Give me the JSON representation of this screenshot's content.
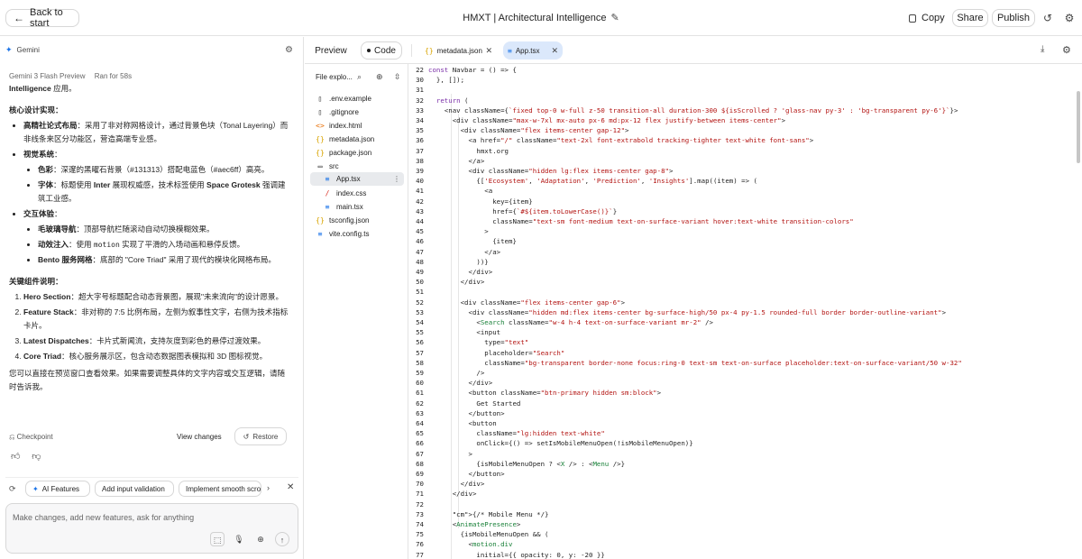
{
  "topbar": {
    "back_label": "Back to start",
    "title": "HMXT | Architectural Intelligence",
    "copy_label": "Copy",
    "share_label": "Share",
    "publish_label": "Publish"
  },
  "chat": {
    "header": "Gemini",
    "model": "Gemini 3 Flash Preview",
    "runtime": "Ran for 58s",
    "intro_bold": "Intelligence",
    "intro_rest": " 应用。",
    "section1_title": "核心设计实现：",
    "b1_title": "高精社论式布局",
    "b1_text": "：采用了非对称网格设计，通过背景色块（Tonal Layering）而非线条来区分功能区，营造高端专业感。",
    "b2_title": "视觉系统",
    "b2_sub1_title": "色彩",
    "b2_sub1_text": "：深邃的黑曜石背景（#131313）搭配电蓝色（#aec6ff）高亮。",
    "b2_sub2_title": "字体",
    "b2_sub2_text_a": "：标题使用 ",
    "b2_sub2_inter": "Inter",
    "b2_sub2_text_b": " 展现权威感，技术标签使用 ",
    "b2_sub2_grotesk": "Space Grotesk",
    "b2_sub2_text_c": " 强调建筑工业感。",
    "b3_title": "交互体验",
    "b3_sub1_title": "毛玻璃导航",
    "b3_sub1_text": "：顶部导航栏随滚动自动切换模糊效果。",
    "b3_sub2_title": "动效注入",
    "b3_sub2_text_a": "：使用 ",
    "b3_sub2_code": "motion",
    "b3_sub2_text_b": " 实现了平滑的入场动画和悬停反馈。",
    "b3_sub3_title": "Bento 服务网格",
    "b3_sub3_text": "：底部的 \"Core Triad\" 采用了现代的模块化网格布局。",
    "section2_title": "关键组件说明：",
    "o1_title": "Hero Section",
    "o1_text": "：超大字号标题配合动态背景图，展现\"未来流向\"的设计愿景。",
    "o2_title": "Feature Stack",
    "o2_text": "：非对称的 7:5 比例布局，左侧为叙事性文字，右侧为技术指标卡片。",
    "o3_title": "Latest Dispatches",
    "o3_text": "：卡片式新闻流，支持灰度到彩色的悬停过渡效果。",
    "o4_title": "Core Triad",
    "o4_text": "：核心服务展示区，包含动态数据图表模拟和 3D 图标视觉。",
    "closing": "您可以直接在预览窗口查看效果。如果需要调整具体的文字内容或交互逻辑，请随时告诉我。",
    "checkpoint_label": "Checkpoint",
    "view_changes_label": "View changes",
    "restore_label": "Restore",
    "suggestions": [
      "AI Features",
      "Add input validation",
      "Implement smooth scro"
    ],
    "prompt_placeholder": "Make changes, add new features, ask for anything"
  },
  "editor": {
    "preview_label": "Preview",
    "code_label": "Code",
    "tabs": [
      {
        "label": "metadata.json",
        "icon": "{}"
      },
      {
        "label": "App.tsx",
        "icon": "≡"
      }
    ]
  },
  "explorer": {
    "title": "File explo...",
    "files": [
      {
        "name": ".env.example",
        "icon": "file-icon"
      },
      {
        "name": ".gitignore",
        "icon": "file-icon"
      },
      {
        "name": "index.html",
        "icon": "html-icon"
      },
      {
        "name": "metadata.json",
        "icon": "json-icon"
      },
      {
        "name": "package.json",
        "icon": "json-icon"
      },
      {
        "name": "src",
        "icon": "folder-icon"
      },
      {
        "name": "App.tsx",
        "icon": "tsx-icon"
      },
      {
        "name": "index.css",
        "icon": "css-icon"
      },
      {
        "name": "main.tsx",
        "icon": "tsx-icon"
      },
      {
        "name": "tsconfig.json",
        "icon": "json-icon"
      },
      {
        "name": "vite.config.ts",
        "icon": "ts-icon"
      }
    ]
  },
  "code": {
    "lines": [
      {
        "n": "22",
        "t": "const Navbar = () => {"
      },
      {
        "n": "30",
        "t": "  }, []);"
      },
      {
        "n": "31",
        "t": ""
      },
      {
        "n": "32",
        "t": "  return ("
      },
      {
        "n": "33",
        "t": "    <nav className={`fixed top-0 w-full z-50 transition-all duration-300 ${isScrolled ? 'glass-nav py-3' : 'bg-transparent py-6'}`}>"
      },
      {
        "n": "34",
        "t": "      <div className=\"max-w-7xl mx-auto px-6 md:px-12 flex justify-between items-center\">"
      },
      {
        "n": "35",
        "t": "        <div className=\"flex items-center gap-12\">"
      },
      {
        "n": "36",
        "t": "          <a href=\"/\" className=\"text-2xl font-extrabold tracking-tighter text-white font-sans\">"
      },
      {
        "n": "37",
        "t": "            hmxt.org"
      },
      {
        "n": "38",
        "t": "          </a>"
      },
      {
        "n": "39",
        "t": "          <div className=\"hidden lg:flex items-center gap-8\">"
      },
      {
        "n": "40",
        "t": "            {['Ecosystem', 'Adaptation', 'Prediction', 'Insights'].map((item) => ("
      },
      {
        "n": "41",
        "t": "              <a"
      },
      {
        "n": "42",
        "t": "                key={item}"
      },
      {
        "n": "43",
        "t": "                href={`#${item.toLowerCase()}`}"
      },
      {
        "n": "44",
        "t": "                className=\"text-sm font-medium text-on-surface-variant hover:text-white transition-colors\""
      },
      {
        "n": "45",
        "t": "              >"
      },
      {
        "n": "46",
        "t": "                {item}"
      },
      {
        "n": "47",
        "t": "              </a>"
      },
      {
        "n": "48",
        "t": "            ))}"
      },
      {
        "n": "49",
        "t": "          </div>"
      },
      {
        "n": "50",
        "t": "        </div>"
      },
      {
        "n": "51",
        "t": ""
      },
      {
        "n": "52",
        "t": "        <div className=\"flex items-center gap-6\">"
      },
      {
        "n": "53",
        "t": "          <div className=\"hidden md:flex items-center bg-surface-high/50 px-4 py-1.5 rounded-full border border-outline-variant\">"
      },
      {
        "n": "54",
        "t": "            <Search className=\"w-4 h-4 text-on-surface-variant mr-2\" />"
      },
      {
        "n": "55",
        "t": "            <input"
      },
      {
        "n": "56",
        "t": "              type=\"text\""
      },
      {
        "n": "57",
        "t": "              placeholder=\"Search\""
      },
      {
        "n": "58",
        "t": "              className=\"bg-transparent border-none focus:ring-0 text-sm text-on-surface placeholder:text-on-surface-variant/50 w-32\""
      },
      {
        "n": "59",
        "t": "            />"
      },
      {
        "n": "60",
        "t": "          </div>"
      },
      {
        "n": "61",
        "t": "          <button className=\"btn-primary hidden sm:block\">"
      },
      {
        "n": "62",
        "t": "            Get Started"
      },
      {
        "n": "63",
        "t": "          </button>"
      },
      {
        "n": "64",
        "t": "          <button"
      },
      {
        "n": "65",
        "t": "            className=\"lg:hidden text-white\""
      },
      {
        "n": "66",
        "t": "            onClick={() => setIsMobileMenuOpen(!isMobileMenuOpen)}"
      },
      {
        "n": "67",
        "t": "          >"
      },
      {
        "n": "68",
        "t": "            {isMobileMenuOpen ? <X /> : <Menu />}"
      },
      {
        "n": "69",
        "t": "          </button>"
      },
      {
        "n": "70",
        "t": "        </div>"
      },
      {
        "n": "71",
        "t": "      </div>"
      },
      {
        "n": "72",
        "t": ""
      },
      {
        "n": "73",
        "t": "      {/* Mobile Menu */}"
      },
      {
        "n": "74",
        "t": "      <AnimatePresence>"
      },
      {
        "n": "75",
        "t": "        {isMobileMenuOpen && ("
      },
      {
        "n": "76",
        "t": "          <motion.div"
      },
      {
        "n": "77",
        "t": "            initial={{ opacity: 0, y: -20 }}"
      }
    ]
  }
}
